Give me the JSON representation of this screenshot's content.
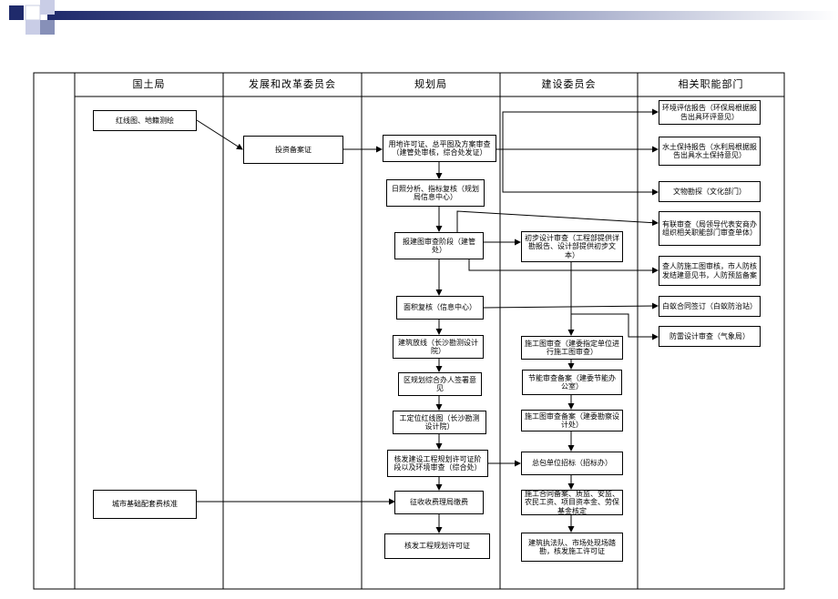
{
  "columns": [
    "国土局",
    "发展和改革委员会",
    "规划局",
    "建设委员会",
    "相关职能部门"
  ],
  "steps": {
    "land_redline": "红线图、地籍测绘",
    "land_fee": "城市基础配套费核准",
    "drc_filing": "投资备案证",
    "plan_permit": "用地许可证、总平图及方案审查（建管处审核，综合处发证）",
    "plan_analysis": "日照分析、指标复核（规划局信息中心）",
    "plan_review": "报建图审查阶段（建管处）",
    "plan_area": "面积复核（信息中心）",
    "plan_setout": "建筑放线（长沙勘测设计院）",
    "plan_opinion": "区规划综合办人签署意见",
    "plan_redline": "工定位红线图（长沙勘测设计院）",
    "plan_license": "核发建设工程规划许可证阶段以及环境审查（综合处）",
    "plan_fee": "征收收费理局缴费",
    "plan_issue": "核发工程规划许可证",
    "con_prelim": "初步设计审查（工程部提供详勘报告、设计部提供初步文本）",
    "con_drawing": "施工图审查（建委指定单位进行施工图审查）",
    "con_energy": "节能审查备案（建委节能办公室）",
    "con_filing": "施工图审查备案（建委勘察设计处）",
    "con_bidding": "总包单位招标（招标办）",
    "con_contract": "施工合同备案、质监、安监、农民工资、项目资本金、劳保基金核定",
    "con_permit": "建筑执法队、市场处现场踏勘，核发施工许可证",
    "rel_env": "环境评估报告（环保局根据报告出具环评意见）",
    "rel_water": "水土保持报告（水利局根据报告出具水土保持意见）",
    "rel_relic": "文物勘探（文化部门）",
    "rel_joint": "有联审查（局领导代表安商办组织相关职能部门审查单体）",
    "rel_civil": "查人防施工图审核，市人防核发结建意见书，人防预监备案",
    "rel_contract": "白蚁合同签订（白蚁防治站）",
    "rel_lightning": "防雷设计审查（气象局）"
  }
}
